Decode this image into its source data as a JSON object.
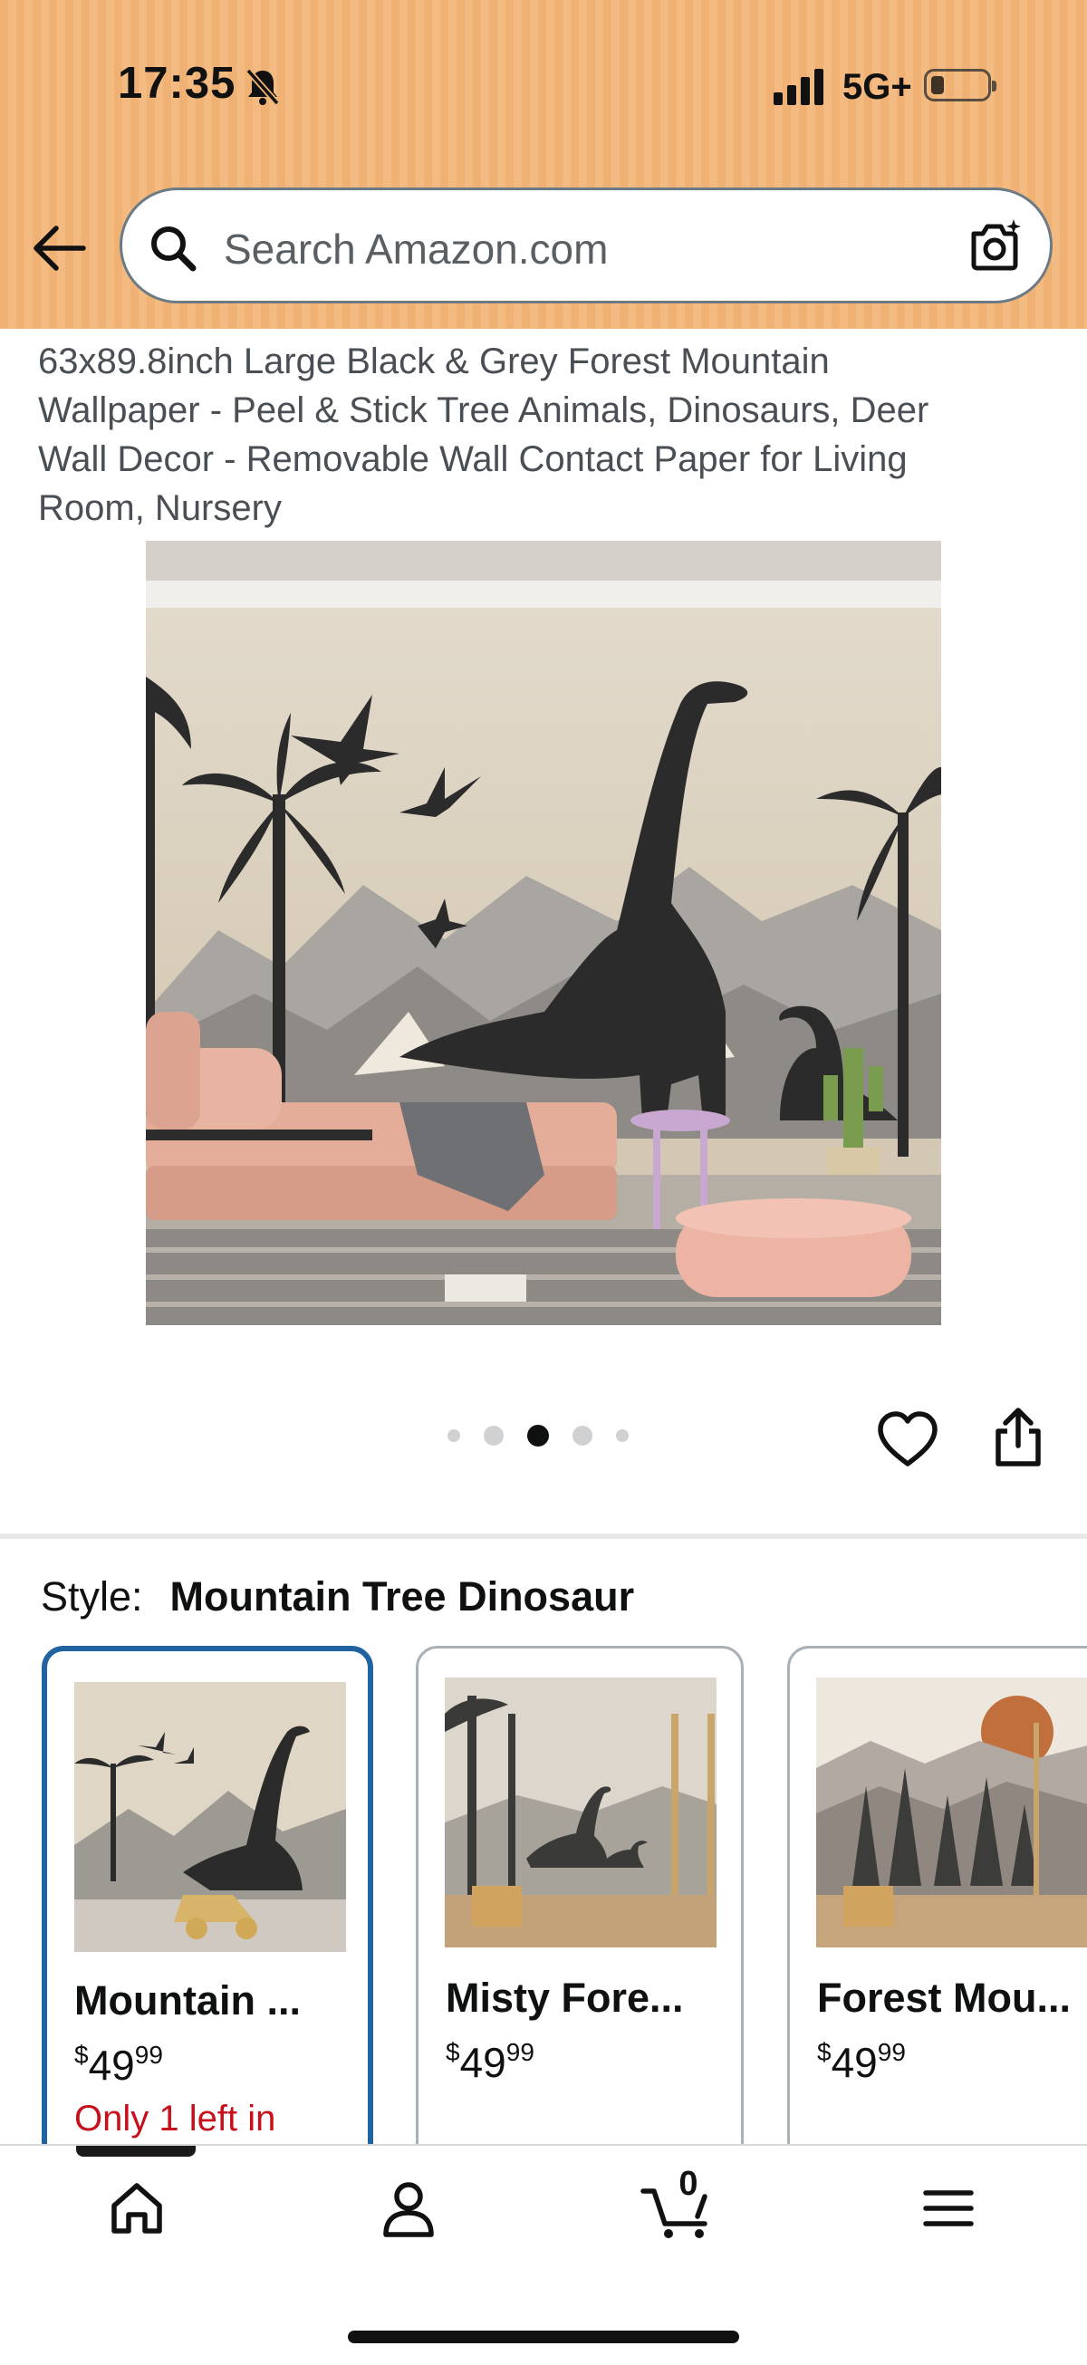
{
  "status_bar": {
    "time": "17:35",
    "network": "5G+"
  },
  "search": {
    "placeholder": "Search Amazon.com"
  },
  "product": {
    "title": "63x89.8inch Large Black & Grey Forest Mountain Wallpaper - Peel & Stick Tree Animals, Dinosaurs, Deer Wall Decor - Removable Wall Contact Paper for Living Room, Nursery",
    "image_count": 5,
    "active_image_index": 3
  },
  "style": {
    "label": "Style:",
    "selected": "Mountain Tree Dinosaur",
    "options": [
      {
        "name": "Mountain ...",
        "currency": "$",
        "dollars": "49",
        "cents": "99",
        "stock": "Only 1 left in"
      },
      {
        "name": "Misty Fore...",
        "currency": "$",
        "dollars": "49",
        "cents": "99"
      },
      {
        "name": "Forest Mou...",
        "currency": "$",
        "dollars": "49",
        "cents": "99"
      }
    ]
  },
  "bottom_nav": {
    "cart_count": "0"
  },
  "colors": {
    "header": "#efb274",
    "selected_border": "#2162a1",
    "stock_red": "#c7101c"
  }
}
